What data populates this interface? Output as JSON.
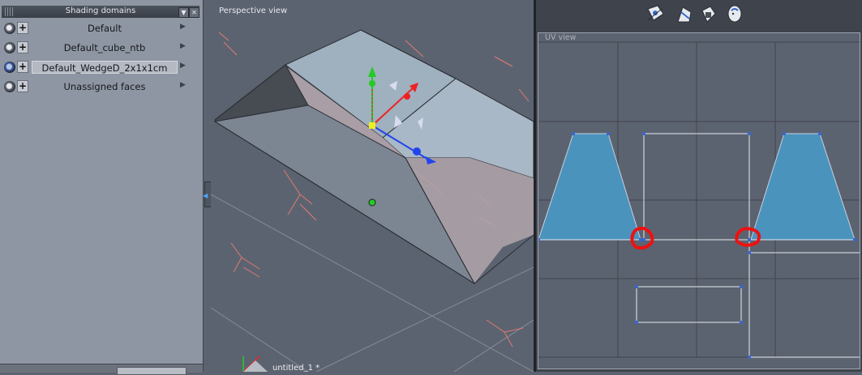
{
  "shading_panel": {
    "title": "Shading domains",
    "domains": [
      {
        "label": "Default",
        "selected": false
      },
      {
        "label": "Default_cube_ntb",
        "selected": false
      },
      {
        "label": "Default_WedgeD_2x1x1cm",
        "selected": true
      },
      {
        "label": "Unassigned faces",
        "selected": false
      }
    ],
    "header_buttons": [
      "▼",
      "✕"
    ]
  },
  "perspective_view": {
    "label": "Perspective view",
    "bottom_label": "untitled_1 *"
  },
  "uv_view": {
    "label": "UV view"
  },
  "toolbar": {
    "icons": [
      "uv-select-icon",
      "uv-paint-icon",
      "uv-bucket-icon",
      "uv-head-icon"
    ]
  },
  "colors": {
    "uv_fill": "#4a93bd",
    "annotation": "#ee1111",
    "gizmo_x": "#ee2222",
    "gizmo_y": "#22cc22",
    "gizmo_z": "#2244ee"
  }
}
